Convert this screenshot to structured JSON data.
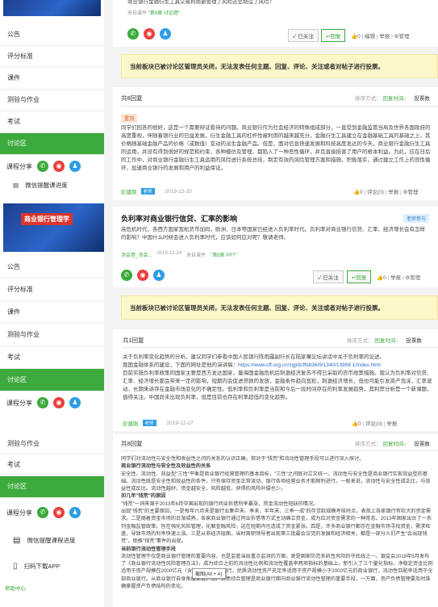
{
  "sidebar_top": {
    "items": [
      "公告",
      "评分标准",
      "课件",
      "测验与作业",
      "考试",
      "讨论区"
    ],
    "share_label": "课程分享",
    "wechat_label": "微信提醒课进度"
  },
  "sidebar_mid": {
    "banner_text": "商业银行管理学",
    "items": [
      "公告",
      "评分标准",
      "课件",
      "测验与作业",
      "考试",
      "讨论区"
    ],
    "share_label": "课程分享",
    "wechat_label": "微信提醒课进度"
  },
  "sidebar_bottom": {
    "items": [
      "测验与作业",
      "考试",
      "讨论区"
    ],
    "share_label": "课程分享",
    "wechat_label": "微信提醒课程进度",
    "app_label": "扫码下载APP",
    "help_label": "帮助中心"
  },
  "thread1": {
    "question_tail": "商业银行金融衍生工具交易利用避管理了风险还是制造了风险？",
    "from_prefix": "来自课件",
    "from_link": "\"第8章 讨论题\"",
    "followed_btn": "✓ 已关注",
    "reply_btn": "回复",
    "count": "0",
    "edit": "编辑",
    "report": "举报",
    "manage": "管理"
  },
  "notice_text": "当前板块已被讨论区管理员关闭，无法发表任何主题、回复、评论、关注或者对帖子进行投票。",
  "reply_list1": {
    "count_label": "共8回复",
    "sort_label": "排序方式：",
    "sort_value": "回复时间",
    "vote_label": "投票数",
    "top_tag": "置顶",
    "body": "同学们回答的很好，这是一个需要辩证看待的问题。商业银行作为社会经济的特殊组成部分，一直受到金融监管当局及世界各国政府的高度重视，伴随着银行业的日益发展，衍生金融工具的杠杆性被利用的越来越充分，金融衍生工具建立在金融基础工具的基础之上，其价格随基础金融产品的价格（或数值）变动的派生金融产品。但是，面对信息快速发展和科技高度发达的今天，商业银行金融衍生工具的运用，并没有得到很好的规范和约束，各种模仿及管理，都陷入了一种恶性循环，并且直接损害了用户的根本利益。为此，应在日后的工作中，对商业银行金融衍生工具运用的风险进行系统总结，制定有效的风险管理方案和措施，积极落实，通过建立工作上的良性循环，加速商业银行的发展和用户的利益保证。",
    "author": "彭建刚",
    "badge": "老师",
    "date": "2019-12-20",
    "likes": "0",
    "comments": "评论(0)",
    "report": "举报",
    "manage": "管理"
  },
  "thread2": {
    "title": "负利率对商业银行信贷、汇率的影响",
    "badge": "老师参与",
    "body": "高危机时代，各西方国家宽松货币加码，欧洲、日本等国家已经进入负利率时代。负利率对商业银行信贷、汇率、经济增长会有怎样的影响？中国什么时候会进入负利率时代，应该如何应对呢？敬请老师。",
    "author": "汤会登_汤会...",
    "date": "2019-12-24",
    "from_prefix": "来自课件",
    "from_link": "\"第8章 PPT\"",
    "followed_btn": "✓ 已关注",
    "reply_btn": "回复",
    "count": "0",
    "report": "举报",
    "manage": "管理"
  },
  "reply_list2": {
    "count_label": "共1回复",
    "sort_label": "排序方式：",
    "sort_value": "回复时间",
    "vote_label": "投票数",
    "body1": "关于负利率变化趋势的分析，建议同学们参看中国人民银行陈雨露副行长在陆家嘴论坛讲话中关于负利率的论述。",
    "url_prefix": "我国金融体系的建设，下面的网址是他的演讲稿：",
    "url": "https://www.cff.org.cn/zgjrltcfftdt36/9/1340/13998 1/index.html",
    "body2": "目前实施负利率政策的国家主要是西方发达国家，量海国金融危机后刺激经济复苏不得已采取的货币政策措施。我认为负利率对信贷、汇率、经济增长都会带来一定的影响，短期内会促进贷款的发放，金融条件趋向宽松，刺激经济增长，但也可能引发资产泡沫，汇率波动，长期来讲存在金融市场变化的不确定性。低利率和负利率是当前和今后一段时间存在的利率发展趋势，其利弊分析是一个新课题，值得关注。中国尚未出现负利率，但是目前也存在利率超低的变化趋势。",
    "author": "彭建刚",
    "badge": "老师",
    "date": "2019-12-27",
    "likes": "0",
    "comments": "评论(0)",
    "report": "举报",
    "manage": "管理"
  },
  "reply_list3": {
    "count_label": "共8回复",
    "sort_label": "排序方式：",
    "sort_value": "回复时间",
    "vote_label": "投票数",
    "intro": "同学们对流动性与安全性和收益性之间的关系的认识正确，但对于\"钱荒\"和流动性管理手段可以进行深入探讨。",
    "h1": "商业银行流动性与安全性及效益性的关系",
    "p1": "安全性、流动性、效益型\"三性\"平衡是商业银行经营管理的基本目标，\"三性\"之间既对立又统一。流动性与安全性是商业银行实现效益型的基础。流动性既是安全性和效益性的条件，只有保持资金正常流动，银行各项经营业务才能顺利进行。一般来说，流动性与安全性成正比，与效益性成反比。流动性越好，资金越安全，风险越低，获得的风险补偿也少。",
    "h2": "卯几年\"钱荒\"的原因",
    "p2": "\"钱荒\"一词来源于2013年6月中国出现的银行间业拆借利率暴涨，资金流动性短缺的情况。",
    "p3": "出现\"钱荒\"的主要原因，一是每年六月末是银行业集中末、季末、半年末、三季一成\"的存贷款规模考核时点，表现上各家银行有较大的资金需求。二是随着资金市场的日渐成熟，各家商业银行通过同业拆借等方式主动确立资金，成为应对资金需求的一种常态。2013年国家出台了一系列金融监管政策，旨在强化风险管理，化解金融风险，这在短期内也造成了资金紧张。四是，许多商业银行都存在金融市场寻找资金，需求旺盛，导致市场的利率快速上涨。三是从非经济层面，当时离职领导者出现第三批最会议党的发展和经济相关，都是一部分人们产生\"会出现钱荒\"，助推\"钱荒\"事件的出现。",
    "h3": "当前银行流动性管理手段",
    "p4": "流动性管理不仅是商业银行管理的重要内容，也是监管当局重点监测的方面，更是国家防范系统性风险的守底线之一。银监会2018年5月发布了《商业银行流动性风险管理办法》，成为综合之前的流动性比例和流动性覆盖率两项指标的基础上，新引入了三个量化指标，净稳定资金比例适用于资产规模在2000亿元（含）以上的商业银行，优质流动性资产充足率适用于资产规模小于2000亿元的商业银行，流动性匹配率适用于全部商业银行。从商业银行自身角度来说，资产负债综合管理是商业银行面向商业银行流动性管理的重要手段，一万面，资产负债管理要及时准确掌握资产负债结构的变化。"
  },
  "screenshot_tip": "截图(Alt + A)"
}
